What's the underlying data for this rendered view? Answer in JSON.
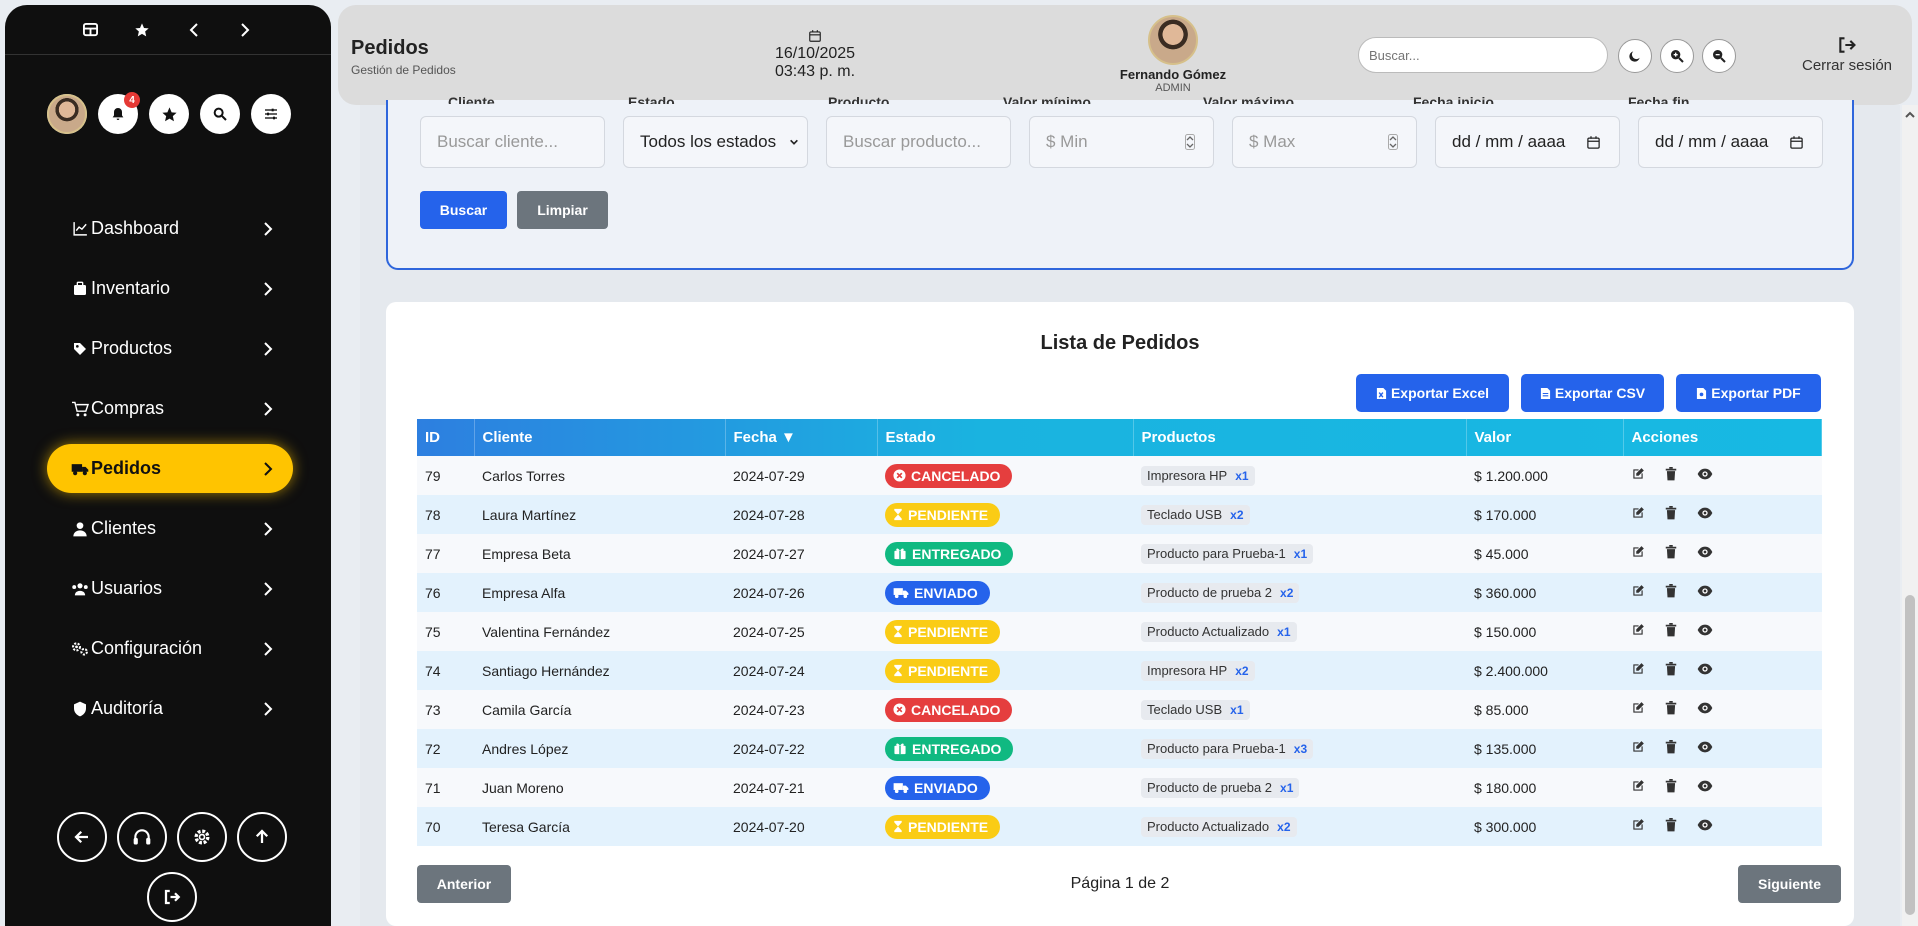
{
  "sidebar": {
    "notification_count": "4",
    "menu": [
      {
        "label": "Dashboard",
        "icon": "chart-line-icon"
      },
      {
        "label": "Inventario",
        "icon": "box-icon"
      },
      {
        "label": "Productos",
        "icon": "tag-icon"
      },
      {
        "label": "Compras",
        "icon": "cart-icon"
      },
      {
        "label": "Pedidos",
        "icon": "truck-icon",
        "active": true
      },
      {
        "label": "Clientes",
        "icon": "user-icon"
      },
      {
        "label": "Usuarios",
        "icon": "users-icon"
      },
      {
        "label": "Configuración",
        "icon": "cogs-icon"
      },
      {
        "label": "Auditoría",
        "icon": "shield-icon"
      }
    ]
  },
  "header": {
    "title": "Pedidos",
    "subtitle": "Gestión de Pedidos",
    "date": "16/10/2025",
    "time": "03:43 p. m.",
    "user_name": "Fernando Gómez",
    "user_role": "ADMIN",
    "search_placeholder": "Buscar...",
    "logout_label": "Cerrar sesión"
  },
  "filters": {
    "labels": [
      "Cliente",
      "Estado",
      "Producto",
      "Valor mínimo",
      "Valor máximo",
      "Fecha inicio",
      "Fecha fin"
    ],
    "cliente_placeholder": "Buscar cliente...",
    "estado_value": "Todos los estados",
    "producto_placeholder": "Buscar producto...",
    "min_placeholder": "$ Min",
    "max_placeholder": "$ Max",
    "date_placeholder": "dd / mm / aaaa",
    "search_button": "Buscar",
    "clear_button": "Limpiar"
  },
  "list": {
    "title": "Lista de Pedidos",
    "export_excel": "Exportar Excel",
    "export_csv": "Exportar CSV",
    "export_pdf": "Exportar PDF",
    "columns": [
      "ID",
      "Cliente",
      "Fecha ▼",
      "Estado",
      "Productos",
      "Valor",
      "Acciones"
    ],
    "rows": [
      {
        "id": "79",
        "cliente": "Carlos Torres",
        "fecha": "2024-07-29",
        "estado": "CANCELADO",
        "producto": "Impresora HP",
        "qty": "x1",
        "valor": "$ 1.200.000"
      },
      {
        "id": "78",
        "cliente": "Laura Martínez",
        "fecha": "2024-07-28",
        "estado": "PENDIENTE",
        "producto": "Teclado USB",
        "qty": "x2",
        "valor": "$ 170.000"
      },
      {
        "id": "77",
        "cliente": "Empresa Beta",
        "fecha": "2024-07-27",
        "estado": "ENTREGADO",
        "producto": "Producto para Prueba-1",
        "qty": "x1",
        "valor": "$ 45.000"
      },
      {
        "id": "76",
        "cliente": "Empresa Alfa",
        "fecha": "2024-07-26",
        "estado": "ENVIADO",
        "producto": "Producto de prueba 2",
        "qty": "x2",
        "valor": "$ 360.000"
      },
      {
        "id": "75",
        "cliente": "Valentina Fernández",
        "fecha": "2024-07-25",
        "estado": "PENDIENTE",
        "producto": "Producto Actualizado",
        "qty": "x1",
        "valor": "$ 150.000"
      },
      {
        "id": "74",
        "cliente": "Santiago Hernández",
        "fecha": "2024-07-24",
        "estado": "PENDIENTE",
        "producto": "Impresora HP",
        "qty": "x2",
        "valor": "$ 2.400.000"
      },
      {
        "id": "73",
        "cliente": "Camila García",
        "fecha": "2024-07-23",
        "estado": "CANCELADO",
        "producto": "Teclado USB",
        "qty": "x1",
        "valor": "$ 85.000"
      },
      {
        "id": "72",
        "cliente": "Andres López",
        "fecha": "2024-07-22",
        "estado": "ENTREGADO",
        "producto": "Producto para Prueba-1",
        "qty": "x3",
        "valor": "$ 135.000"
      },
      {
        "id": "71",
        "cliente": "Juan Moreno",
        "fecha": "2024-07-21",
        "estado": "ENVIADO",
        "producto": "Producto de prueba 2",
        "qty": "x1",
        "valor": "$ 180.000"
      },
      {
        "id": "70",
        "cliente": "Teresa García",
        "fecha": "2024-07-20",
        "estado": "PENDIENTE",
        "producto": "Producto Actualizado",
        "qty": "x2",
        "valor": "$ 300.000"
      }
    ],
    "prev_button": "Anterior",
    "page_text": "Página 1 de 2",
    "next_button": "Siguiente"
  },
  "colors": {
    "accent_blue": "#2563eb",
    "active_menu": "#ffc400",
    "cancelado": "#e53e3e",
    "pendiente": "#facc15",
    "entregado": "#10b981",
    "enviado": "#2563eb"
  }
}
